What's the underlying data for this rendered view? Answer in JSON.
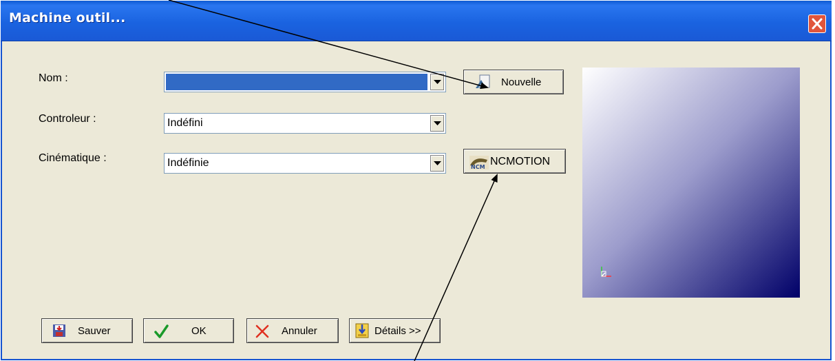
{
  "window": {
    "title": "Machine outil..."
  },
  "form": {
    "nom_label": "Nom :",
    "nom_value": "",
    "controleur_label": "Controleur :",
    "controleur_value": "Indéfini",
    "cinematique_label": "Cinématique :",
    "cinematique_value": "Indéfinie"
  },
  "buttons": {
    "nouvelle": "Nouvelle",
    "ncmotion": "NCMOTION",
    "sauver": "Sauver",
    "ok": "OK",
    "annuler": "Annuler",
    "details": "Détails >>"
  },
  "icons": {
    "close": "close-icon",
    "dropdown": "chevron-down-icon",
    "nouvelle": "new-machine-icon",
    "ncmotion": "ncm-logo-icon",
    "sauver": "save-icon",
    "ok": "checkmark-icon",
    "annuler": "x-cancel-icon",
    "details": "details-icon",
    "axes": "axis-triad-icon"
  },
  "colors": {
    "titlebar": "#1a63e0",
    "selection": "#316ac5",
    "dialog_bg": "#ece9d8",
    "preview_dark": "#000068"
  }
}
